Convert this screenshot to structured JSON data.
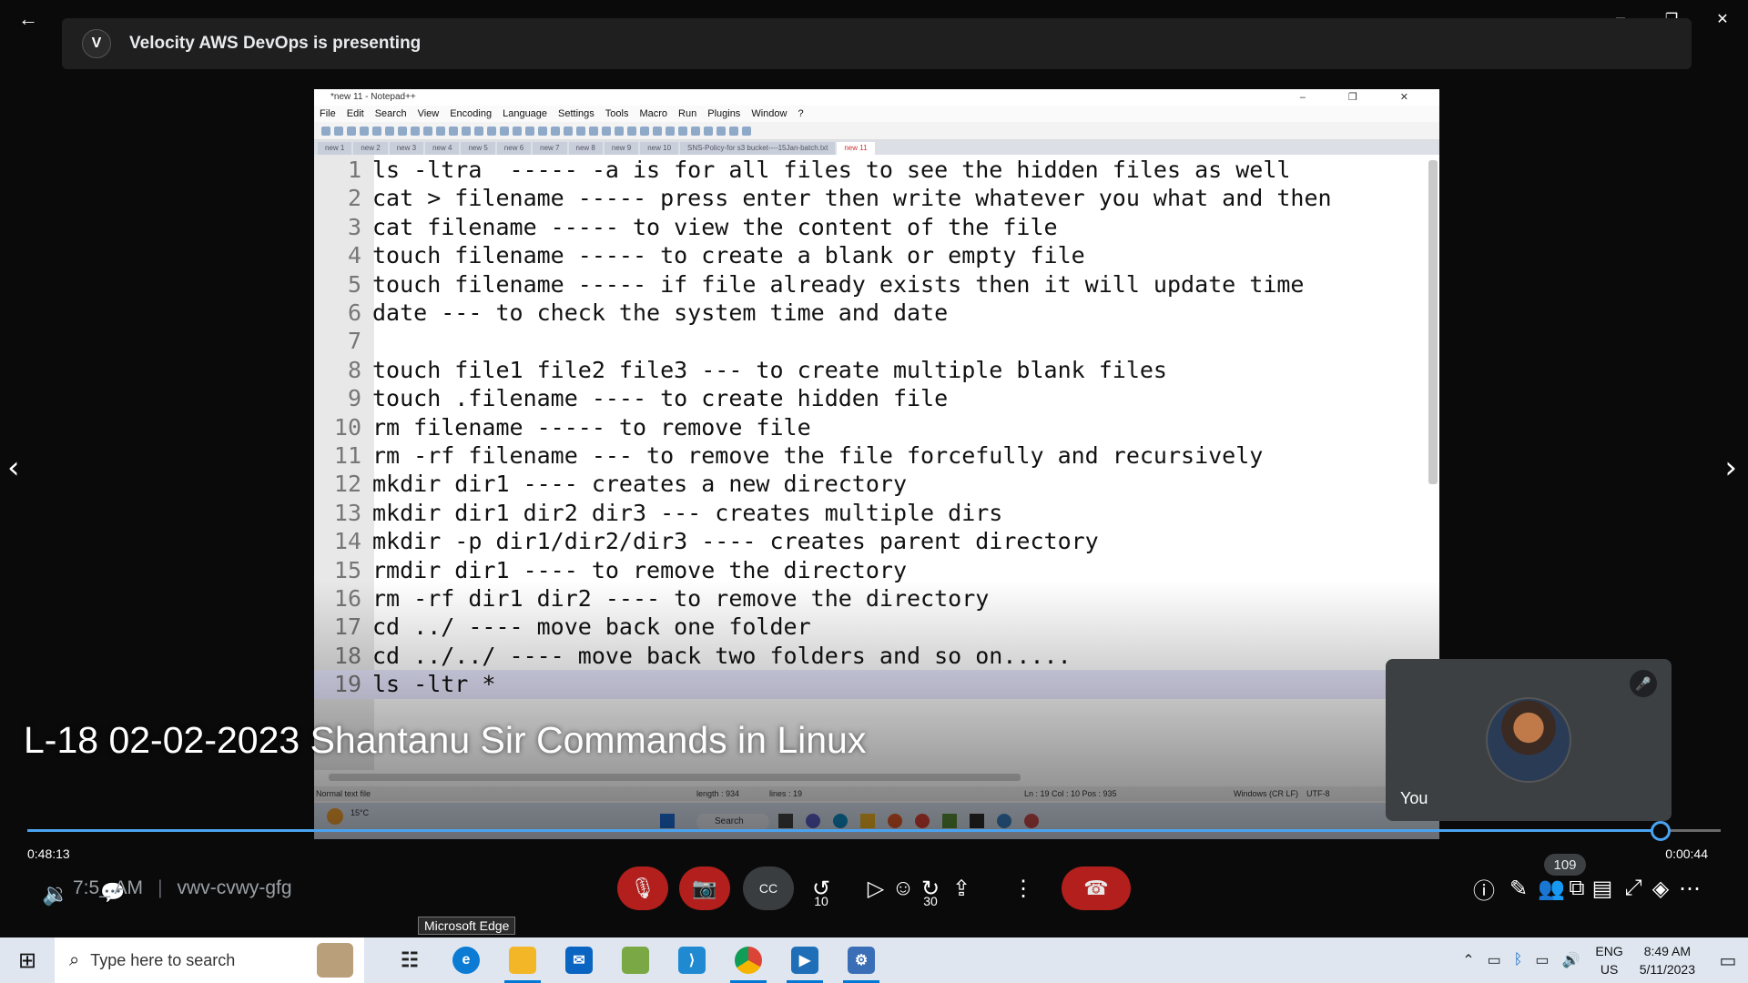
{
  "window": {
    "back": "←",
    "controls": [
      "─",
      "❐",
      "✕"
    ]
  },
  "presenting": {
    "logo": "V",
    "text": "Velocity AWS DevOps is presenting"
  },
  "notepad": {
    "title": "*new 11 - Notepad++",
    "title_controls": "– ❐ ✕",
    "menu": [
      "File",
      "Edit",
      "Search",
      "View",
      "Encoding",
      "Language",
      "Settings",
      "Tools",
      "Macro",
      "Run",
      "Plugins",
      "Window",
      "?"
    ],
    "tabs": [
      "new 1",
      "new 2",
      "new 3",
      "new 4",
      "new 5",
      "new 6",
      "new 7",
      "new 8",
      "new 9",
      "new 10",
      "SNS-Policy-for s3 bucket----15Jan-batch.txt",
      "new 11"
    ],
    "active_tab": "new 11",
    "lines": [
      {
        "n": "1",
        "text": "ls -ltra  ----- -a is for all files to see the hidden files as well"
      },
      {
        "n": "2",
        "text": "cat > filename ----- press enter then write whatever you what and then"
      },
      {
        "n": "3",
        "text": "cat filename ----- to view the content of the file"
      },
      {
        "n": "4",
        "text": "touch filename ----- to create a blank or empty file"
      },
      {
        "n": "5",
        "text": "touch filename ----- if file already exists then it will update time"
      },
      {
        "n": "6",
        "text": "date --- to check the system time and date"
      },
      {
        "n": "7",
        "text": ""
      },
      {
        "n": "8",
        "text": "touch file1 file2 file3 --- to create multiple blank files"
      },
      {
        "n": "9",
        "text": "touch .filename ---- to create hidden file"
      },
      {
        "n": "10",
        "text": "rm filename ----- to remove file"
      },
      {
        "n": "11",
        "text": "rm -rf filename --- to remove the file forcefully and recursively"
      },
      {
        "n": "12",
        "text": "mkdir dir1 ---- creates a new directory"
      },
      {
        "n": "13",
        "text": "mkdir dir1 dir2 dir3 --- creates multiple dirs"
      },
      {
        "n": "14",
        "text": "mkdir -p dir1/dir2/dir3 ---- creates parent directory"
      },
      {
        "n": "15",
        "text": "rmdir dir1 ---- to remove the directory"
      },
      {
        "n": "16",
        "text": "rm -rf dir1 dir2 ---- to remove the directory"
      },
      {
        "n": "17",
        "text": "cd ../ ---- move back one folder"
      },
      {
        "n": "18",
        "text": "cd ../../ ---- move back two folders and so on....."
      },
      {
        "n": "19",
        "text": "ls -ltr *"
      }
    ],
    "current_line": 19,
    "status": {
      "type": "Normal text file",
      "length": "length : 934",
      "lines": "lines : 19",
      "pos": "Ln : 19    Col : 10    Pos : 935",
      "eol": "Windows (CR LF)",
      "enc": "UTF-8"
    },
    "inner_taskbar": {
      "weather": "15°C",
      "search": "Search"
    }
  },
  "lecture_title": "L-18 02-02-2023 Shantanu Sir Commands in Linux",
  "self_tile": {
    "name": "You",
    "mute_icon": "🎤"
  },
  "player": {
    "progress": 0.9645,
    "elapsed": "0:48:13",
    "remaining": "0:00:44"
  },
  "meeting": {
    "time": "7:5_ AM",
    "separator": "|",
    "code": "vwv-cvwy-gfg"
  },
  "controls": {
    "mic_icon": "🎙",
    "cam_icon": "📷",
    "captions": "CC",
    "rewind_label": "10",
    "play_icon": "▷",
    "forward_label": "30",
    "more": "⋮",
    "hangup": "☎",
    "participants_count": "109"
  },
  "tooltip": "Microsoft Edge",
  "taskbar": {
    "search_placeholder": "Type here to search",
    "lang_top": "ENG",
    "lang_bottom": "US",
    "time": "8:49 AM",
    "date": "5/11/2023"
  },
  "colors": {
    "accent": "#4aa3f0",
    "hangup": "#c5221f",
    "tile": "#3c4043"
  }
}
